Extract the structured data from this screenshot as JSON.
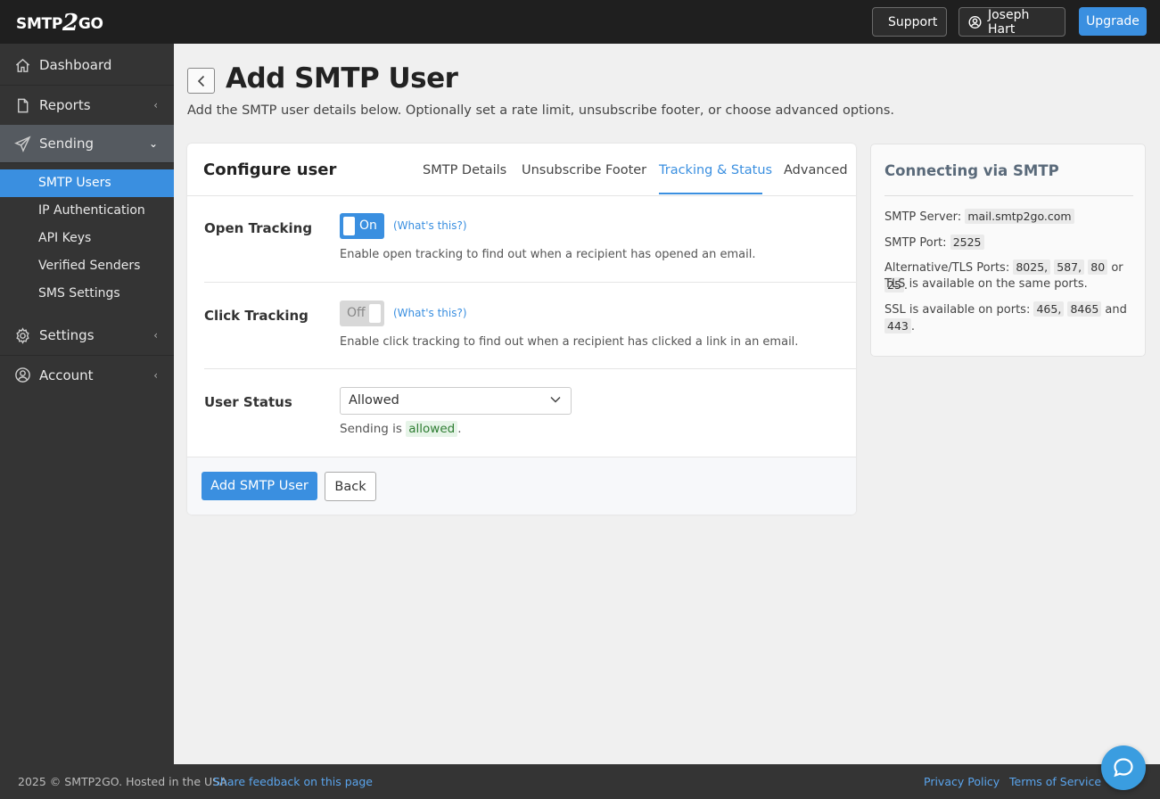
{
  "header": {
    "logo_text_left": "SMTP",
    "logo_text_two": "2",
    "logo_text_right": "GO",
    "support_label": "Support",
    "user_label": "Joseph Hart",
    "upgrade_label": "Upgrade"
  },
  "sidebar": {
    "items": [
      {
        "label": "Dashboard",
        "icon": "home-icon"
      },
      {
        "label": "Reports",
        "icon": "document-icon"
      },
      {
        "label": "Sending",
        "icon": "send-icon"
      },
      {
        "label": "Settings",
        "icon": "gear-icon"
      },
      {
        "label": "Account",
        "icon": "user-circle-icon"
      }
    ],
    "sub_items": [
      {
        "label": "SMTP Users"
      },
      {
        "label": "IP Authentication"
      },
      {
        "label": "API Keys"
      },
      {
        "label": "Verified Senders"
      },
      {
        "label": "SMS Settings"
      }
    ]
  },
  "page": {
    "title": "Add SMTP User",
    "subtitle": "Add the SMTP user details below. Optionally set a rate limit, unsubscribe footer, or choose advanced options."
  },
  "card": {
    "title": "Configure user",
    "tabs": [
      {
        "label": "SMTP Details"
      },
      {
        "label": "Unsubscribe Footer"
      },
      {
        "label": "Tracking & Status"
      },
      {
        "label": "Advanced"
      }
    ],
    "active_tab": "Tracking & Status",
    "open_tracking": {
      "label": "Open Tracking",
      "toggle_text": "On",
      "whats_this": "(What's this?)",
      "help": "Enable open tracking to find out when a recipient has opened an email."
    },
    "click_tracking": {
      "label": "Click Tracking",
      "toggle_text": "Off",
      "whats_this": "(What's this?)",
      "help": "Enable click tracking to find out when a recipient has clicked a link in an email."
    },
    "user_status": {
      "label": "User Status",
      "selected": "Allowed",
      "status_prefix": "Sending is",
      "status_value": "allowed",
      "status_suffix": "."
    },
    "primary_button": "Add SMTP User",
    "secondary_button": "Back"
  },
  "info": {
    "title": "Connecting via SMTP",
    "server_label": "SMTP Server:",
    "server_value": "mail.smtp2go.com",
    "port_label": "SMTP Port:",
    "port_value": "2525",
    "alt_label": "Alternative/TLS Ports:",
    "alt_ports": [
      "8025,",
      "587,",
      "80",
      "25"
    ],
    "alt_or": "or",
    "alt_end": ".",
    "tls_note": "TLS is available on the same ports.",
    "ssl_label": "SSL is available on ports:",
    "ssl_ports": [
      "465,",
      "8465",
      "443"
    ],
    "ssl_and": "and",
    "ssl_end": "."
  },
  "footer": {
    "copyright": "2025 © SMTP2GO. Hosted in the USA",
    "feedback": "Share feedback on this page",
    "privacy": "Privacy Policy",
    "terms": "Terms of Service"
  },
  "colors": {
    "accent": "#3a8fe0",
    "topbar": "#1f1f1f",
    "sidebar": "#343434",
    "status_green": "#2e7d32"
  }
}
